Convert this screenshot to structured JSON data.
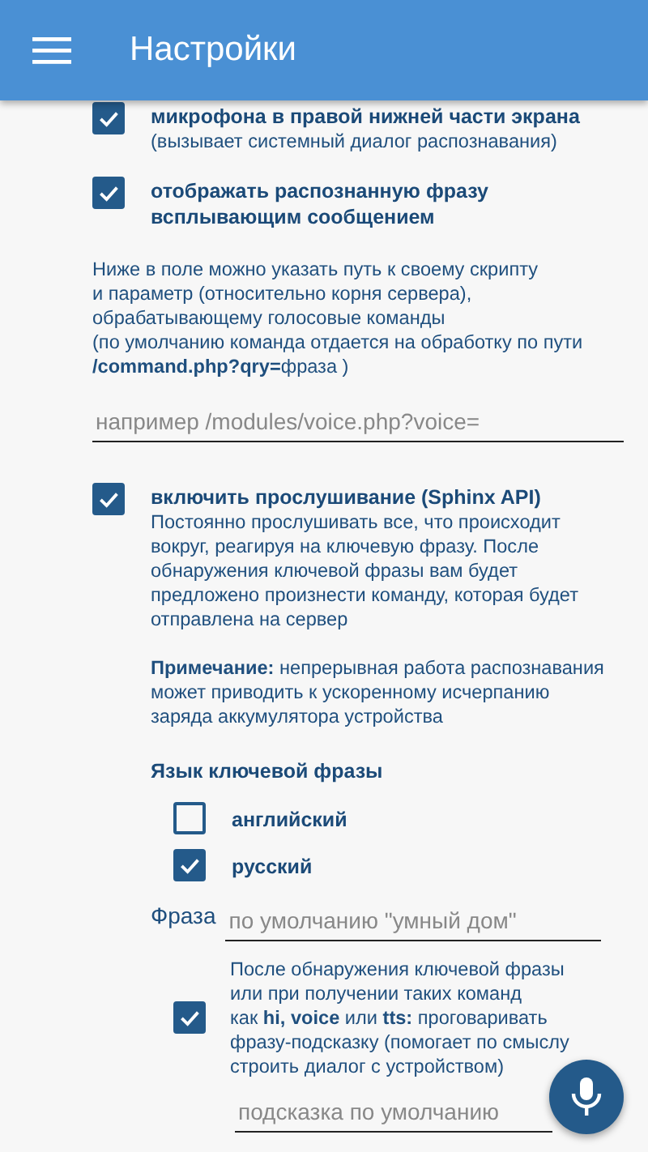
{
  "app_bar": {
    "title": "Настройки"
  },
  "options": [
    {
      "label_lines": [
        "микрофона в правой нижней части экрана"
      ],
      "description_lines": [
        "(вызывает системный диалог распознавания)"
      ],
      "checked": true
    },
    {
      "label_lines": [
        "отображать распознанную фразу",
        "всплывающим сообщением"
      ],
      "checked": true
    }
  ],
  "script_note_lines": [
    "Ниже в поле можно указать путь к своему скрипту",
    "и параметр (относительно корня сервера),",
    "обрабатывающему голосовые команды",
    "(по умолчанию команда отдается на обработку по пути",
    "**/command.php?qry=**фраза )"
  ],
  "script_field": {
    "placeholder": "например /modules/voice.php?voice="
  },
  "listening": {
    "label": "включить прослушивание (Sphinx API)",
    "checked": true,
    "description_lines": [
      "Постоянно прослушивать все, что происходит",
      "вокруг, реагируя на ключевую фразу. После",
      "обнаружения ключевой фразы вам будет",
      "предложено произнести команду, которая будет",
      "отправлена на сервер"
    ],
    "note_lines": [
      "**Примечание:** непрерывная работа распознавания",
      "может приводить к ускоренному исчерпанию",
      "заряда аккумулятора устройства"
    ]
  },
  "keyphrase_language": {
    "heading": "Язык ключевой фразы",
    "options": [
      {
        "label": "английский",
        "checked": false
      },
      {
        "label": "русский",
        "checked": true
      }
    ]
  },
  "phrase_field": {
    "label": "Фраза",
    "placeholder": "по умолчанию \"умный дом\""
  },
  "hint_option": {
    "checked": true,
    "text_lines": [
      "После обнаружения ключевой фразы",
      "или при получении таких команд",
      "как **hi, voice** или **tts:** проговаривать",
      "фразу-подсказку (помогает по смыслу",
      "строить диалог с устройством)"
    ]
  },
  "hint_field": {
    "placeholder": "подсказка по умолчанию"
  }
}
